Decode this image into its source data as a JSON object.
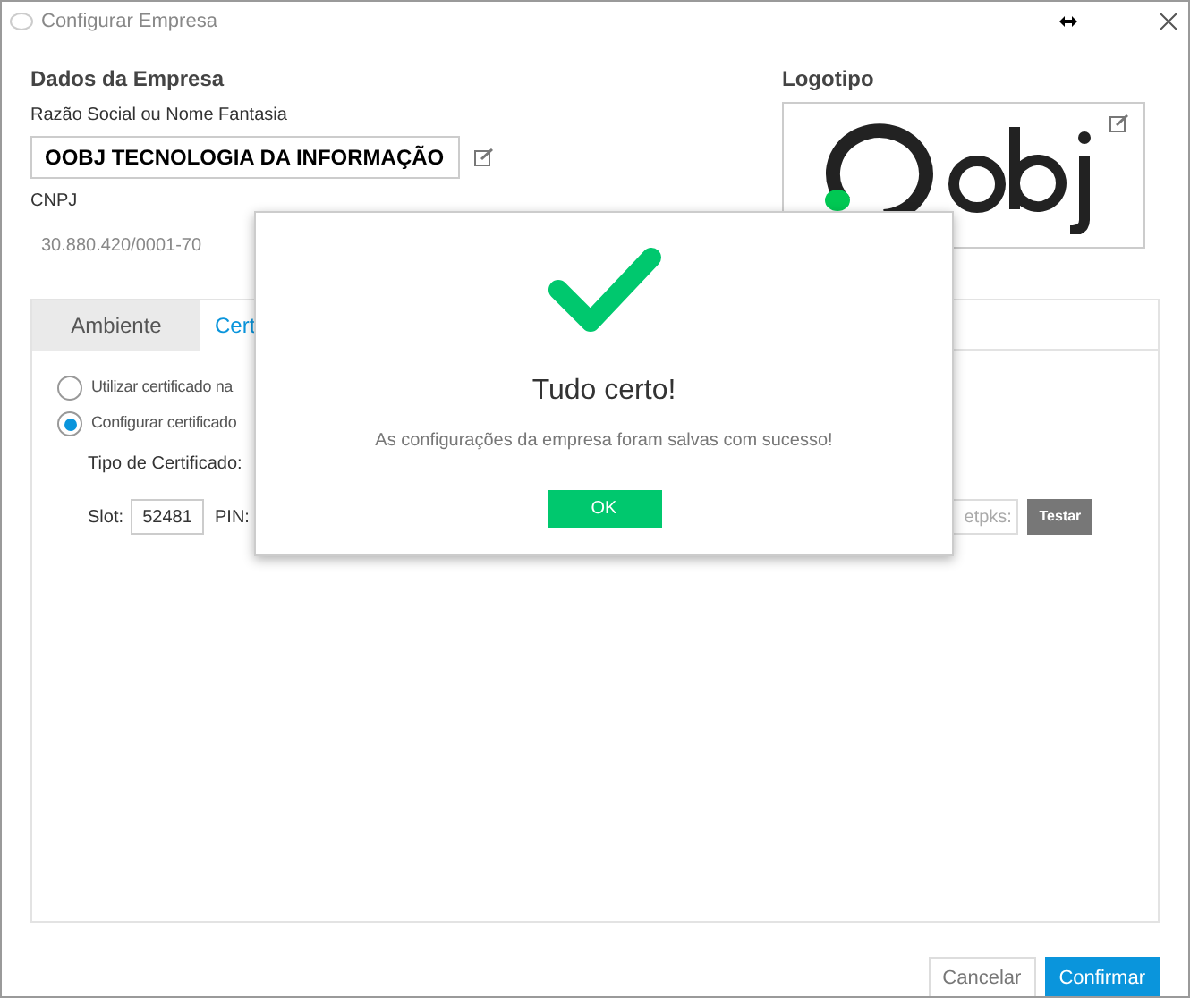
{
  "window": {
    "title": "Configurar Empresa"
  },
  "company": {
    "heading": "Dados da Empresa",
    "name_label": "Razão Social ou Nome Fantasia",
    "name_value": "OOBJ TECNOLOGIA DA INFORMAÇÃO",
    "cnpj_label": "CNPJ",
    "cnpj_value": "30.880.420/0001-70"
  },
  "logo": {
    "heading": "Logotipo"
  },
  "tabs": [
    {
      "label": "Ambiente",
      "selected": false
    },
    {
      "label": "Cert",
      "selected": true
    }
  ],
  "certificate": {
    "options": [
      {
        "label": "Utilizar certificado na",
        "selected": false
      },
      {
        "label": "Configurar certificado",
        "selected": true
      }
    ],
    "type_label": "Tipo de Certificado:",
    "slot_label": "Slot:",
    "slot_value": "52481",
    "pin_label": "PIN:",
    "path_value": "etpks:",
    "test_button": "Testar"
  },
  "buttons": [
    {
      "label": "Cancelar",
      "kind": "secondary"
    },
    {
      "label": "Confirmar",
      "kind": "primary"
    }
  ],
  "dialog": {
    "title": "Tudo certo!",
    "message": "As configurações da empresa foram salvas com sucesso!",
    "button": "OK"
  }
}
